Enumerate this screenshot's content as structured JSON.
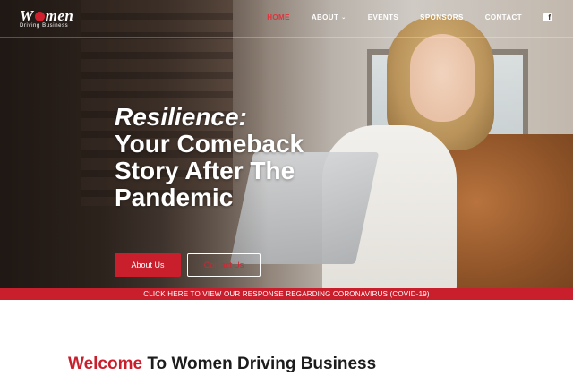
{
  "brand": {
    "logo_big_left": "W",
    "logo_big_right": "men",
    "logo_small": "Driving Business"
  },
  "nav": {
    "items": [
      {
        "label": "HOME",
        "active": true
      },
      {
        "label": "ABOUT",
        "has_dropdown": true
      },
      {
        "label": "EVENTS"
      },
      {
        "label": "SPONSORS"
      },
      {
        "label": "CONTACT"
      }
    ],
    "social_icon": "facebook-icon"
  },
  "hero": {
    "headline_italic": "Resilience:",
    "headline_lines": [
      "Your Comeback",
      "Story After The",
      "Pandemic"
    ],
    "buttons": {
      "about": "About Us",
      "contact": "Contact Us"
    }
  },
  "alert": {
    "text": "CLICK HERE TO VIEW OUR RESPONSE REGARDING CORONAVIRUS (COVID-19)"
  },
  "welcome": {
    "accent": "Welcome",
    "rest": " To Women Driving Business"
  },
  "colors": {
    "brand_red": "#c91f2c",
    "nav_active": "#e0323c",
    "text_dark": "#1c1c1c"
  }
}
